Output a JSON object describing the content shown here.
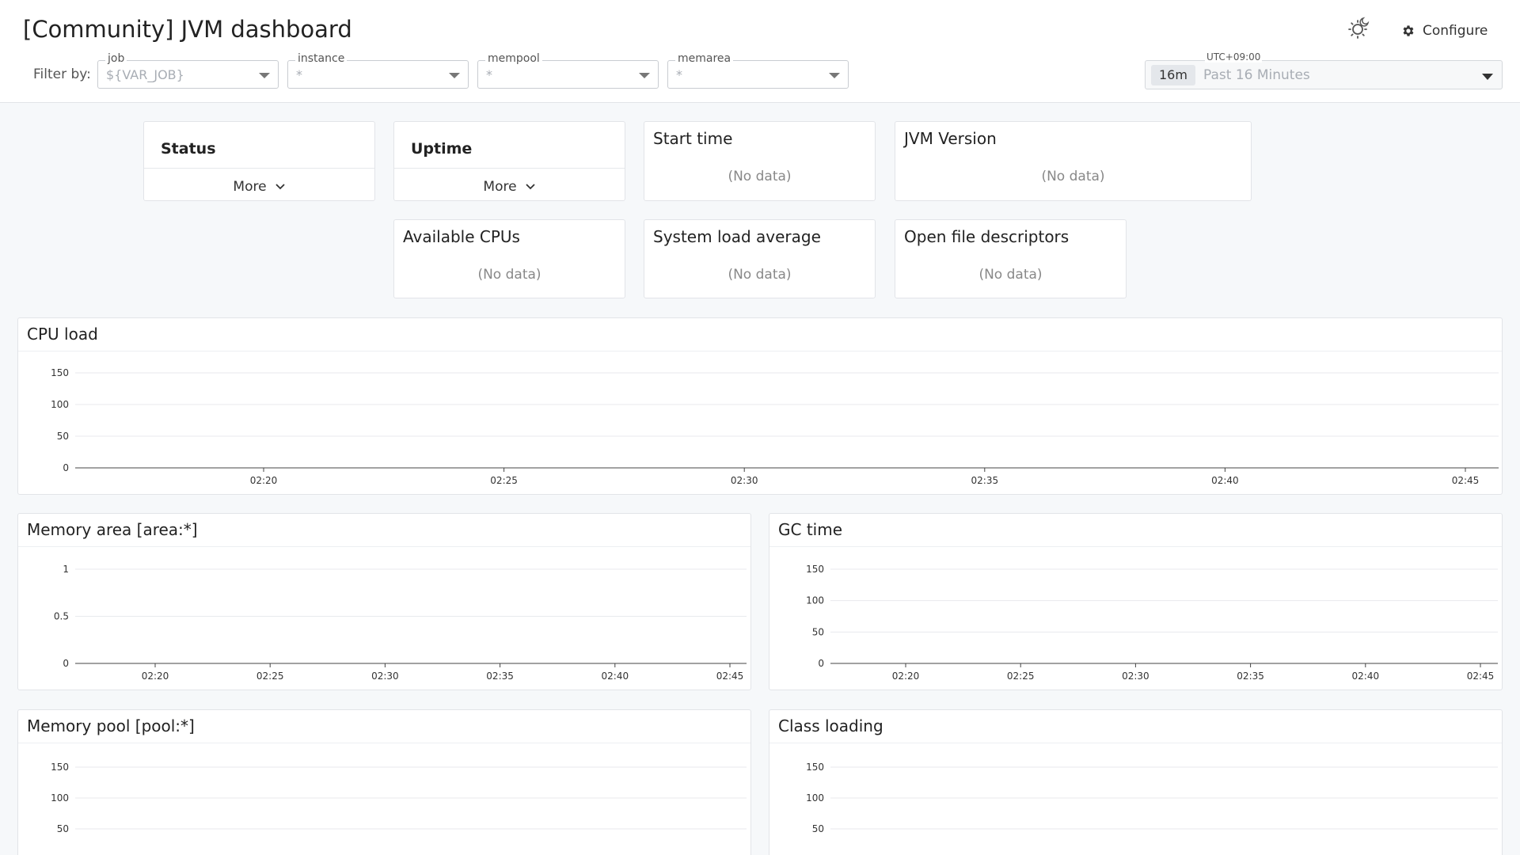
{
  "header": {
    "title": "[Community] JVM dashboard",
    "filter_label": "Filter by:",
    "configure_label": "Configure"
  },
  "filters": [
    {
      "label": "job",
      "value": "${VAR_JOB}"
    },
    {
      "label": "instance",
      "value": "*"
    },
    {
      "label": "mempool",
      "value": "*"
    },
    {
      "label": "memarea",
      "value": "*"
    }
  ],
  "time_picker": {
    "timezone": "UTC+09:00",
    "badge": "16m",
    "range": "Past 16 Minutes"
  },
  "group_cards": [
    {
      "title": "Status",
      "more": "More"
    },
    {
      "title": "Uptime",
      "more": "More"
    }
  ],
  "stat_cards": [
    {
      "title": "Start time",
      "value": "(No data)"
    },
    {
      "title": "JVM Version",
      "value": "(No data)"
    },
    {
      "title": "Available CPUs",
      "value": "(No data)"
    },
    {
      "title": "System load average",
      "value": "(No data)"
    },
    {
      "title": "Open file descriptors",
      "value": "(No data)"
    }
  ],
  "icons": {
    "theme": "theme-toggle-icon",
    "configure": "gear-icon",
    "more": "chevron-down-icon",
    "caret": "caret-down-icon"
  },
  "colors": {
    "axis": "#444444",
    "grid": "#e8eaed",
    "tick_text": "#333333"
  },
  "chart_data": [
    {
      "type": "line",
      "title": "CPU load",
      "x_ticks": [
        "02:20",
        "02:25",
        "02:30",
        "02:35",
        "02:40",
        "02:45"
      ],
      "y_ticks": [
        "0",
        "50",
        "100",
        "150"
      ],
      "ylim": [
        0,
        150
      ],
      "series": [],
      "grid": true
    },
    {
      "type": "line",
      "title": "Memory area [area:*]",
      "x_ticks": [
        "02:20",
        "02:25",
        "02:30",
        "02:35",
        "02:40",
        "02:45"
      ],
      "y_ticks": [
        "0",
        "0.5",
        "1"
      ],
      "ylim": [
        0,
        1
      ],
      "series": [],
      "grid": true
    },
    {
      "type": "line",
      "title": "GC time",
      "x_ticks": [
        "02:20",
        "02:25",
        "02:30",
        "02:35",
        "02:40",
        "02:45"
      ],
      "y_ticks": [
        "0",
        "50",
        "100",
        "150"
      ],
      "ylim": [
        0,
        150
      ],
      "series": [],
      "grid": true
    },
    {
      "type": "line",
      "title": "Memory pool [pool:*]",
      "x_ticks": [],
      "y_ticks": [
        "50",
        "100",
        "150"
      ],
      "ylim": [
        0,
        150
      ],
      "series": [],
      "grid": true
    },
    {
      "type": "line",
      "title": "Class loading",
      "x_ticks": [],
      "y_ticks": [
        "50",
        "100",
        "150"
      ],
      "ylim": [
        0,
        150
      ],
      "series": [],
      "grid": true
    }
  ]
}
